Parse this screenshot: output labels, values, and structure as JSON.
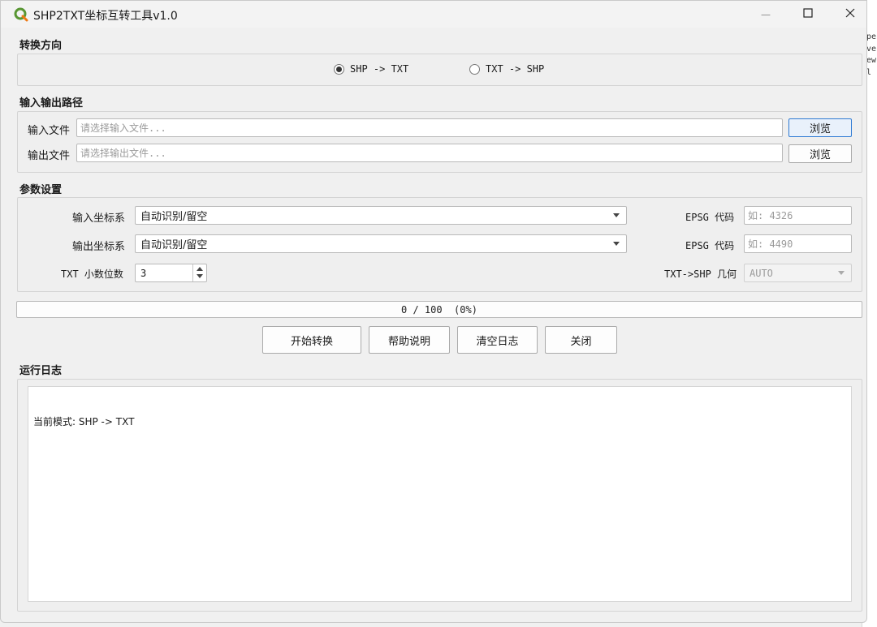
{
  "window": {
    "title": "SHP2TXT坐标互转工具v1.0",
    "icon": "qgis-logo-icon",
    "controls": {
      "minimize": "—",
      "maximize": "☐",
      "close": "✕"
    }
  },
  "direction": {
    "title": "转换方向",
    "options": [
      {
        "label": "SHP -> TXT",
        "checked": true
      },
      {
        "label": "TXT -> SHP",
        "checked": false
      }
    ]
  },
  "paths": {
    "title": "输入输出路径",
    "input_label": "输入文件",
    "input_placeholder": "请选择输入文件...",
    "input_browse": "浏览",
    "output_label": "输出文件",
    "output_placeholder": "请选择输出文件...",
    "output_browse": "浏览"
  },
  "params": {
    "title": "参数设置",
    "in_crs_label": "输入坐标系",
    "in_crs_value": "自动识别/留空",
    "in_epsg_label": "EPSG 代码",
    "in_epsg_placeholder": "如: 4326",
    "out_crs_label": "输出坐标系",
    "out_crs_value": "自动识别/留空",
    "out_epsg_label": "EPSG 代码",
    "out_epsg_placeholder": "如: 4490",
    "decimals_label": "TXT 小数位数",
    "decimals_value": "3",
    "geom_label": "TXT->SHP 几何",
    "geom_value": "AUTO"
  },
  "progress": {
    "text": "0 / 100  (0%)",
    "value": 0,
    "max": 100
  },
  "actions": {
    "start": "开始转换",
    "help": "帮助说明",
    "clear_log": "清空日志",
    "close": "关闭"
  },
  "log": {
    "title": "运行日志",
    "lines": [
      "当前模式: SHP -> TXT"
    ]
  },
  "desktop_strip": {
    "fragments": [
      "pe",
      "ve",
      "ew",
      "l"
    ]
  },
  "colors": {
    "accent": "#2f7bd3",
    "qgis_green": "#589632",
    "qgis_yellow": "#ee7913"
  }
}
